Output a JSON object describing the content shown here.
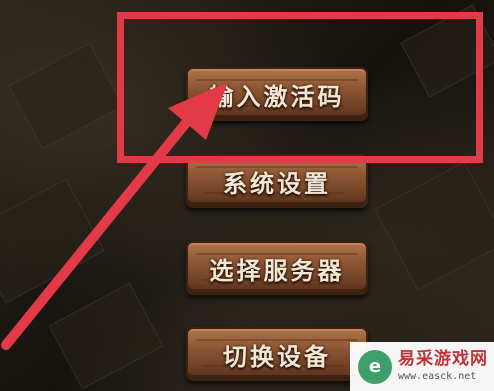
{
  "menu": {
    "items": [
      {
        "label": "输入激活码",
        "highlighted": true
      },
      {
        "label": "系统设置"
      },
      {
        "label": "选择服务器"
      },
      {
        "label": "切换设备"
      }
    ]
  },
  "annotation": {
    "color": "#e23a47"
  },
  "watermark": {
    "logo_glyph": "e",
    "title": "易采游戏网",
    "url": "www.easck.net"
  }
}
